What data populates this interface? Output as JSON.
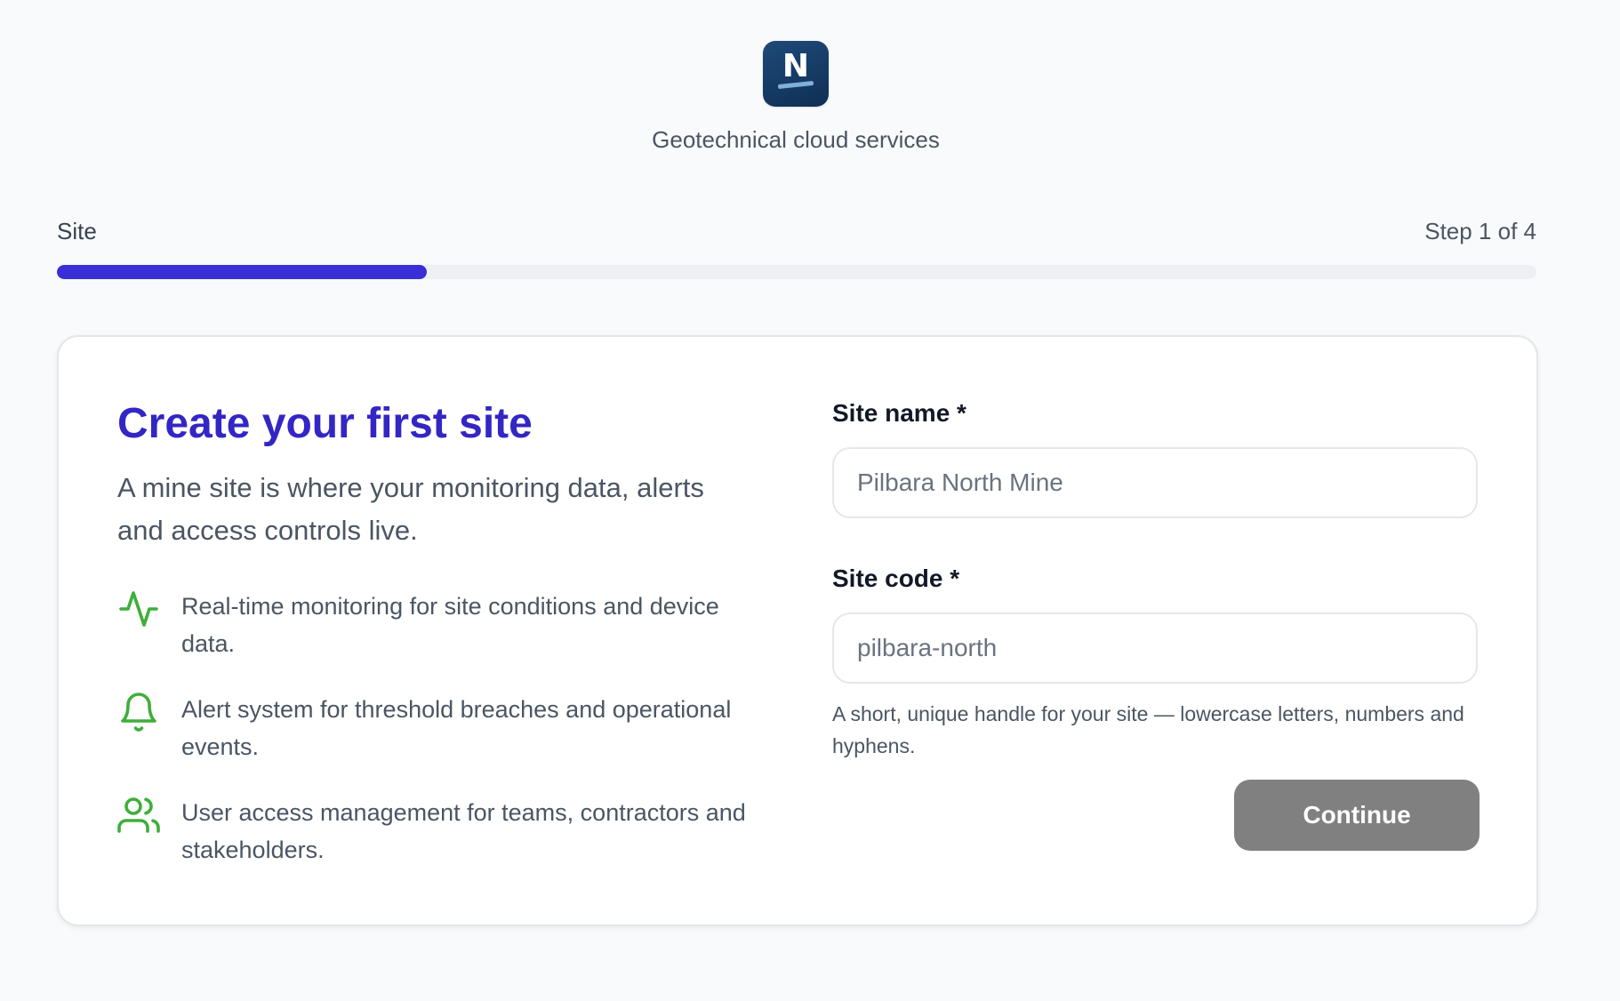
{
  "brand": {
    "logo_letter": "N",
    "tagline": "Geotechnical cloud services"
  },
  "progress": {
    "label": "Site",
    "count": "Step 1 of 4",
    "fraction": 0.25,
    "accent_color": "#3a2fd6"
  },
  "intro": {
    "heading": "Create your first site",
    "lead": "A mine site is where your monitoring data, alerts and access controls live.",
    "features": [
      {
        "icon": "activity-icon",
        "text": "Real-time monitoring for site conditions and device data."
      },
      {
        "icon": "bell-icon",
        "text": "Alert system for threshold breaches and operational events."
      },
      {
        "icon": "users-icon",
        "text": "User access management for teams, contractors and stakeholders."
      }
    ],
    "icon_color": "#3fae3a"
  },
  "form": {
    "site_name": {
      "label": "Site name *",
      "value": "",
      "placeholder": "Pilbara North Mine"
    },
    "site_code": {
      "label": "Site code *",
      "value": "",
      "placeholder": "pilbara-north",
      "hint": "A short, unique handle for your site — lowercase letters, numbers and hyphens."
    },
    "continue_label": "Continue",
    "continue_disabled": true
  }
}
